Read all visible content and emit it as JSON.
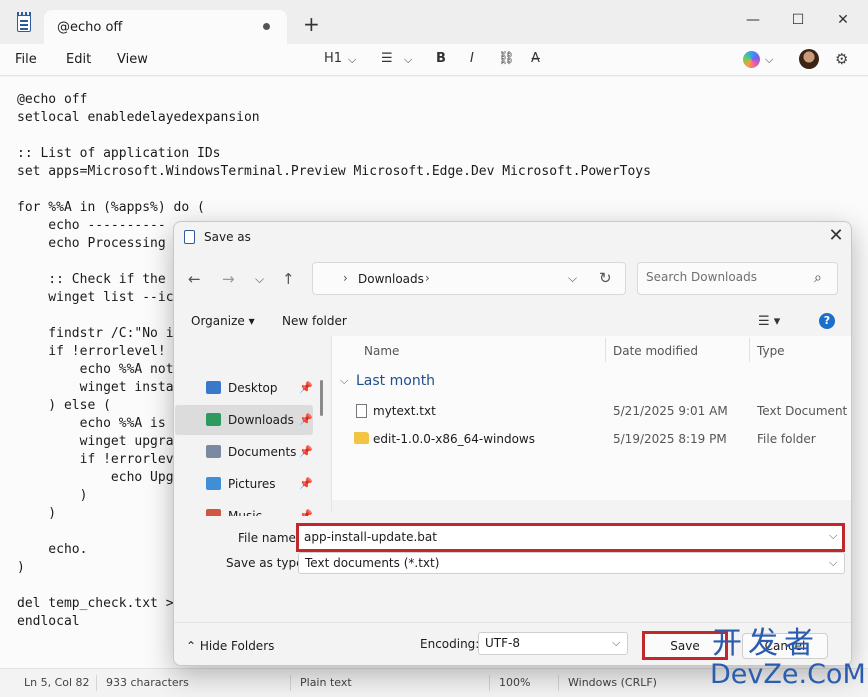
{
  "notepad": {
    "tab_title": "@echo off",
    "new_tab_glyph": "+",
    "window_controls": [
      "—",
      "☐",
      "✕"
    ],
    "menus": [
      "File",
      "Edit",
      "View"
    ],
    "toolbar": {
      "heading_label": "H1",
      "list_glyph": "☰",
      "bold_glyph": "B",
      "italic_glyph": "I",
      "link_glyph": "⛓",
      "clear_format_glyph": "A̶",
      "chevron": "⌵",
      "gear_glyph": "⚙"
    },
    "code_lines": [
      "@echo off",
      "setlocal enabledelayedexpansion",
      "",
      ":: List of application IDs",
      "set apps=Microsoft.WindowsTerminal.Preview Microsoft.Edge.Dev Microsoft.PowerToys",
      "",
      "for %%A in (%apps%) do (",
      "    echo ----------",
      "    echo Processing",
      "",
      "    :: Check if the",
      "    winget list --ic",
      "",
      "    findstr /C:\"No i",
      "    if !errorlevel!",
      "        echo %%A not",
      "        winget insta",
      "    ) else (",
      "        echo %%A is",
      "        winget upgra",
      "        if !errorlev",
      "            echo Upg",
      "        )",
      "    )",
      "",
      "    echo.",
      ")",
      "",
      "del temp_check.txt >",
      "endlocal"
    ],
    "status": {
      "position": "Ln 5, Col 82",
      "characters": "933 characters",
      "format": "Plain text",
      "zoom": "100%",
      "line_ending": "Windows (CRLF)"
    }
  },
  "dialog": {
    "title": "Save as",
    "close_glyph": "✕",
    "nav": {
      "back": "←",
      "forward": "→",
      "recent": "⌵",
      "up": "↑"
    },
    "address": {
      "chevron": "›",
      "path": "Downloads",
      "dropdown": "⌵",
      "refresh": "↻"
    },
    "search": {
      "placeholder": "Search Downloads",
      "icon_glyph": "⌕"
    },
    "commands": {
      "organize": "Organize ▾",
      "new_folder": "New folder",
      "view_glyph": "☰ ▾",
      "help_glyph": "?"
    },
    "nav_items": [
      {
        "label": "Desktop",
        "color": "#3a78c9"
      },
      {
        "label": "Downloads",
        "color": "#2d9b5f",
        "selected": true
      },
      {
        "label": "Documents",
        "color": "#7a8aa0"
      },
      {
        "label": "Pictures",
        "color": "#3f8fd6"
      },
      {
        "label": "Music",
        "color": "#d0563e"
      }
    ],
    "pin_glyph": "📌",
    "columns": {
      "name": "Name",
      "date": "Date modified",
      "type": "Type"
    },
    "group": {
      "chevron": "⌵",
      "label": "Last month"
    },
    "files": [
      {
        "name": "mytext.txt",
        "date": "5/21/2025 9:01 AM",
        "type": "Text Document",
        "icon": "text-file"
      },
      {
        "name": "edit-1.0.0-x86_64-windows",
        "date": "5/19/2025 8:19 PM",
        "type": "File folder",
        "icon": "folder"
      }
    ],
    "file_name_label": "File name:",
    "file_name_value": "app-install-update.bat",
    "save_type_label": "Save as type:",
    "save_type_value": "Text documents (*.txt)",
    "encoding_label": "Encoding:",
    "encoding_value": "UTF-8",
    "hide_folders": "⌃  Hide Folders",
    "save_label": "Save",
    "cancel_label": "Cancel",
    "select_chevron": "⌵"
  },
  "watermark": {
    "line1": "开发者",
    "line2": "DevZe.CoM"
  },
  "colors": {
    "highlight": "#c0282d",
    "accent": "#1a6fc9",
    "folder": "#f3c443"
  }
}
